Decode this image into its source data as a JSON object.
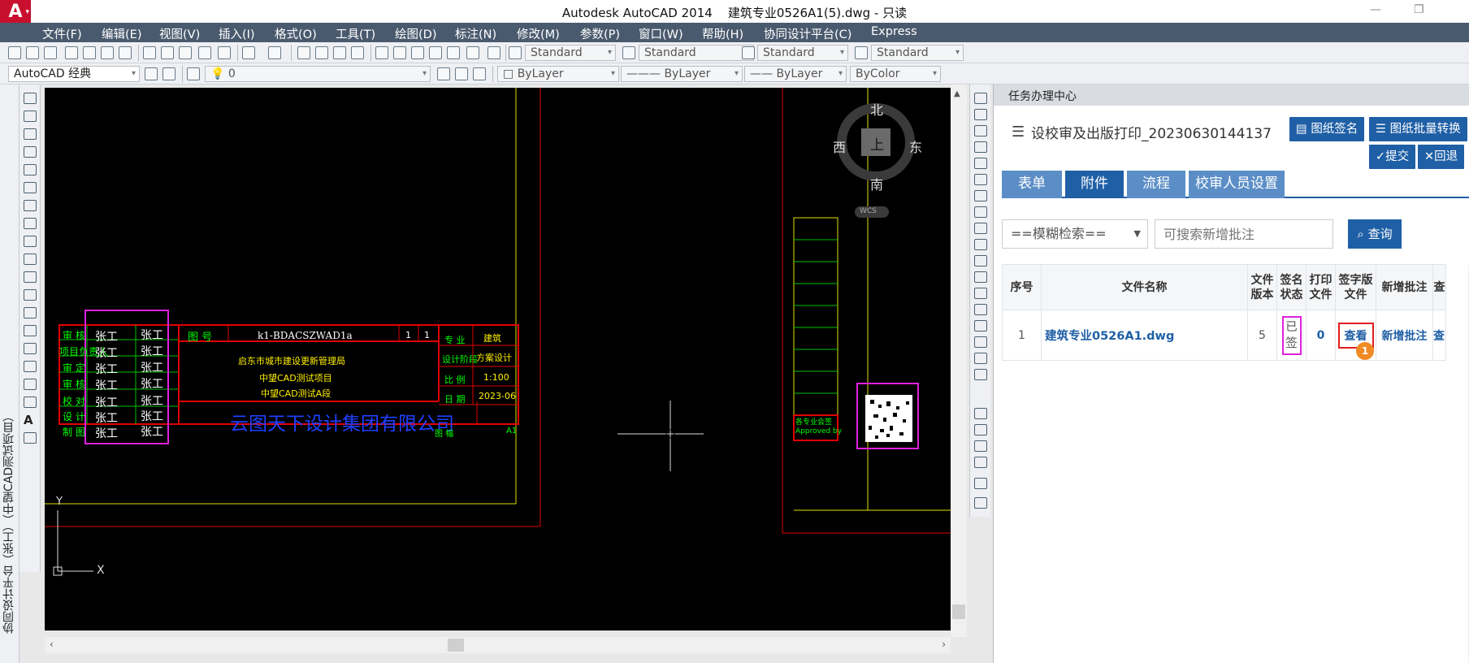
{
  "window": {
    "app_title": "Autodesk AutoCAD 2014",
    "file_title": "建筑专业0526A1(5).dwg - 只读",
    "logo_letter": "A"
  },
  "menu": [
    "文件(F)",
    "编辑(E)",
    "视图(V)",
    "插入(I)",
    "格式(O)",
    "工具(T)",
    "绘图(D)",
    "标注(N)",
    "修改(M)",
    "参数(P)",
    "窗口(W)",
    "帮助(H)",
    "协同设计平台(C)",
    "Express"
  ],
  "toolbar": {
    "styles": [
      "Standard",
      "Standard",
      "Standard",
      "Standard"
    ],
    "workspace": "AutoCAD 经典",
    "layer": "0",
    "color": "ByLayer",
    "linetype": "ByLayer",
    "lineweight": "ByLayer",
    "plotstyle": "ByColor"
  },
  "left_vertical_label": "协同设计平台（张工）（中望CAD测试项目）",
  "canvas": {
    "compass": {
      "north": "北",
      "south": "南",
      "east": "东",
      "west": "西",
      "center": "上",
      "wcs": "WCS"
    },
    "axis": {
      "y": "Y",
      "x": "X"
    },
    "title_block": {
      "roles": [
        "审  核",
        "项目负责人",
        "审  定",
        "审  核",
        "校  对",
        "设  计",
        "制  图"
      ],
      "names": [
        "张工",
        "张工",
        "张工",
        "张工",
        "张工",
        "张工",
        "张工"
      ],
      "signatures": [
        "张工",
        "张工",
        "张工",
        "张工",
        "张工",
        "张工",
        "张工"
      ],
      "drawing_no_label": "图  号",
      "drawing_no": "k1-BDACSZWAD1a",
      "sheet_a": "1",
      "sheet_b": "1",
      "project_lines": [
        "启东市城市建设更新管理局",
        "中望CAD测试项目",
        "中望CAD测试A段"
      ],
      "company": "云图天下设计集团有限公司",
      "specialty_label": "专  业",
      "specialty": "建筑",
      "stage_label": "设计阶段",
      "stage": "方案设计",
      "scale_label": "比  例",
      "scale": "1:100",
      "date_label": "日  期",
      "date": "2023-06",
      "sheet_size_label": "图 幅",
      "sheet_size": "A1"
    },
    "stamp_label_1": "各专业会签",
    "stamp_label_2": "Approved by"
  },
  "panel": {
    "header": "任务办理中心",
    "doc_title": "设校审及出版打印_20230630144137",
    "btn_sign": "图纸签名",
    "btn_batch": "图纸批量转换",
    "btn_submit": "提交",
    "btn_back": "回退",
    "tabs": [
      "表单",
      "附件",
      "流程",
      "校审人员设置"
    ],
    "search_mode": "==模糊检索==",
    "search_placeholder": "可搜索新增批注",
    "search_btn": "查询",
    "columns": [
      "序号",
      "文件名称",
      "文件版本",
      "签名状态",
      "打印文件",
      "签字版文件",
      "新增批注",
      "查"
    ],
    "rows": [
      {
        "index": "1",
        "file": "建筑专业0526A1.dwg",
        "version": "5",
        "sign_status": "已签",
        "print_files": "0",
        "signed_file": "查看",
        "annotation": "新增批注",
        "more": "查"
      }
    ],
    "badge": "1"
  }
}
